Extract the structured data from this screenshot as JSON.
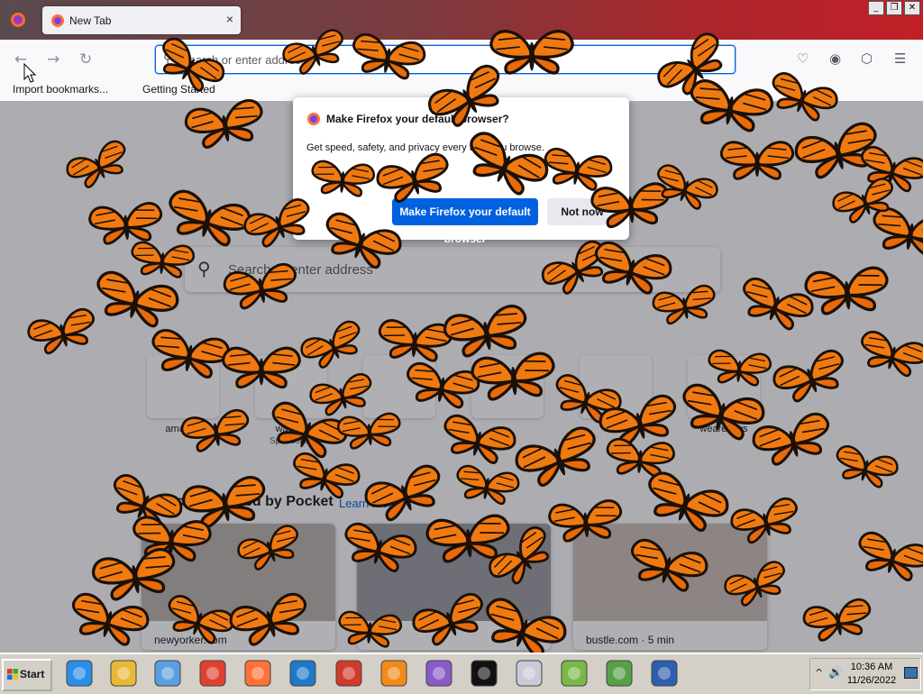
{
  "browser": {
    "tab_title": "New Tab",
    "tab_close": "×",
    "window_controls": [
      "_",
      "❐",
      "✕"
    ],
    "nav": {
      "back": "←",
      "forward": "→",
      "reload": "↻"
    },
    "url_placeholder": "Search or enter address",
    "bookmarks": [
      "Import bookmarks...",
      "Getting Started"
    ]
  },
  "newtab": {
    "search_placeholder": "Search or enter address",
    "shortcuts": [
      {
        "label": "amazon",
        "sub": ""
      },
      {
        "label": "wayfair",
        "sub": "Sponsored"
      },
      {
        "label": "",
        "sub": ""
      },
      {
        "label": "",
        "sub": ""
      },
      {
        "label": "",
        "sub": ""
      },
      {
        "label": "wearedevs",
        "sub": ""
      }
    ],
    "recommended_title": "Recommended by Pocket",
    "learn_more": "Learn more",
    "cards": [
      {
        "source": "newyorker.com"
      },
      {
        "source": ""
      },
      {
        "source": "bustle.com · 5 min"
      }
    ]
  },
  "dialog": {
    "title": "Make Firefox your default browser?",
    "body": "Get speed, safety, and privacy every time you browse.",
    "primary": "Make Firefox your default browser",
    "secondary": "Not now"
  },
  "taskbar": {
    "start": "Start",
    "apps": [
      "internet-explorer",
      "file-explorer",
      "media-player",
      "chrome",
      "firefox",
      "visual-studio-code",
      "red-app",
      "avast",
      "vpn",
      "command-prompt",
      "app-installer",
      "notepad",
      "game-app",
      "floppy-save"
    ],
    "time": "10:36 AM",
    "date": "11/26/2022",
    "tray_up": "^",
    "tray_volume": "🔊"
  },
  "colors": {
    "accent": "#0061e0",
    "butterfly_orange": "#f07a10",
    "butterfly_black": "#1a1008"
  }
}
